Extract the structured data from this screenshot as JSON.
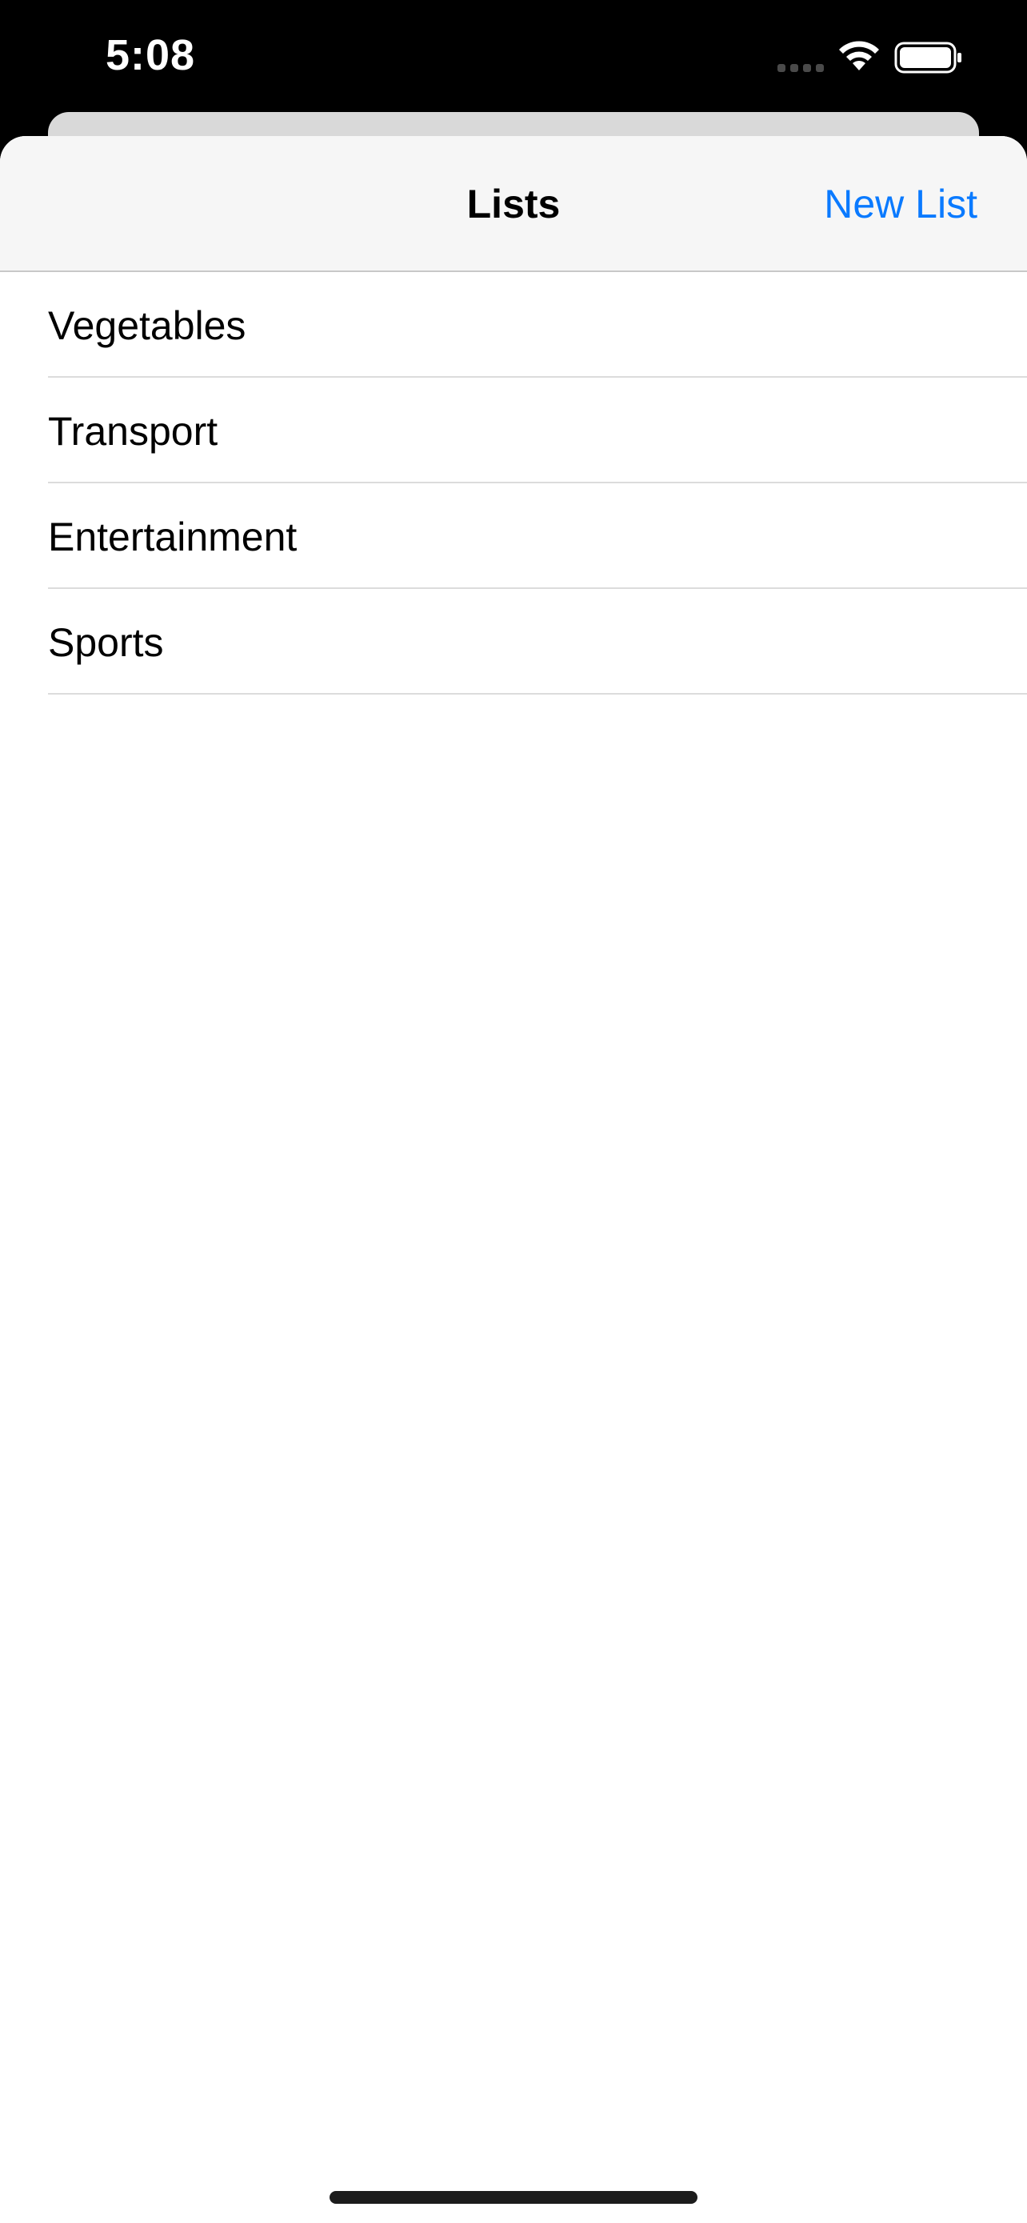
{
  "status_bar": {
    "time": "5:08",
    "signal_icon": "signal-dots-icon",
    "wifi_icon": "wifi-icon",
    "battery_icon": "battery-full-icon"
  },
  "nav": {
    "title": "Lists",
    "new_list_label": "New List"
  },
  "lists": [
    {
      "label": "Vegetables"
    },
    {
      "label": "Transport"
    },
    {
      "label": "Entertainment"
    },
    {
      "label": "Sports"
    }
  ],
  "colors": {
    "accent": "#0a7aff",
    "nav_background": "#f6f6f6",
    "separator": "#dcdcdc"
  }
}
